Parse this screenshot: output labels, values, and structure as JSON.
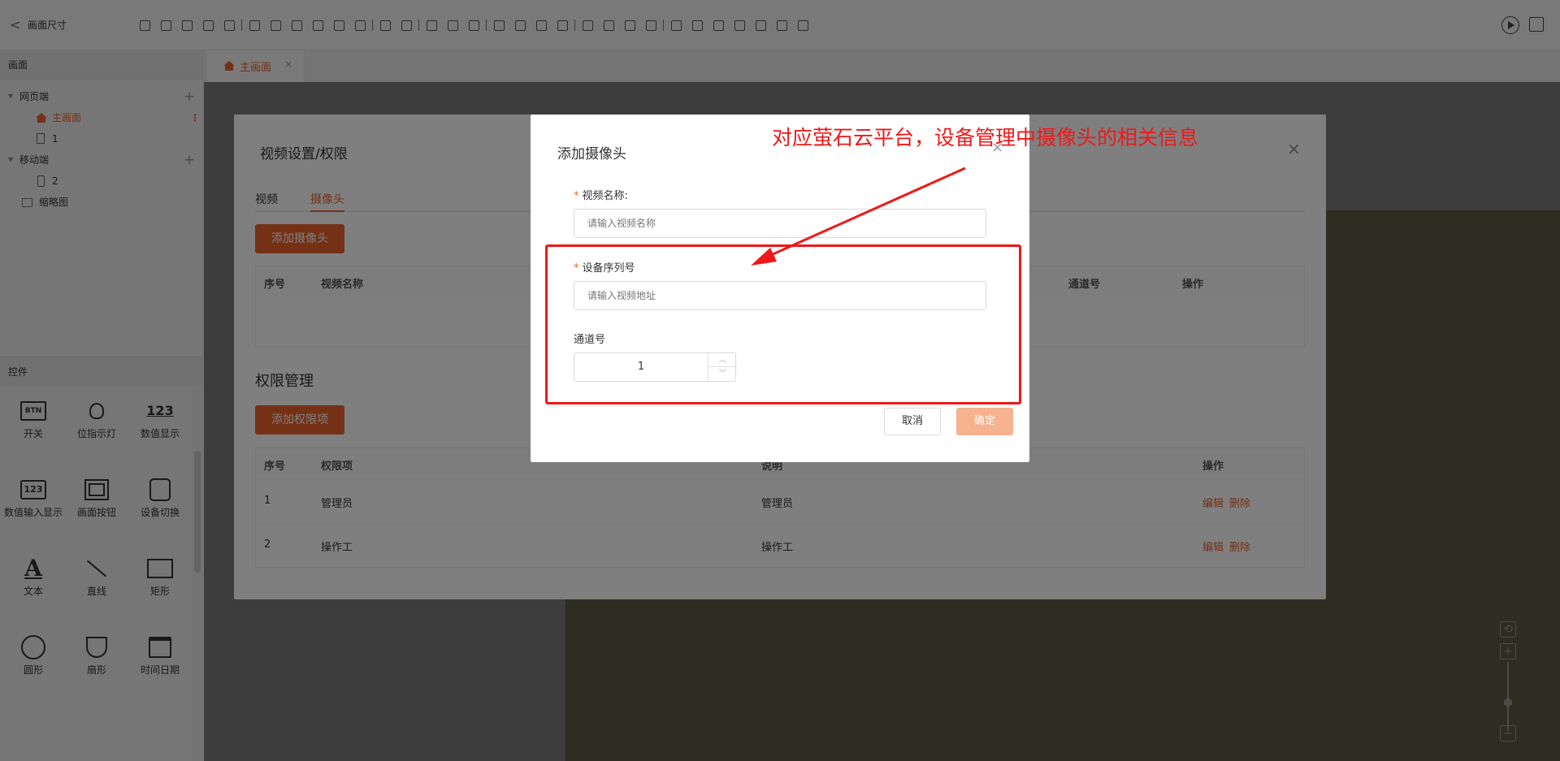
{
  "app": {
    "back_label": "<",
    "title": "画面尺寸"
  },
  "toolbar_icons": [
    "save-icon",
    "save-as-icon",
    "cut-icon",
    "copy-icon",
    "delete-icon",
    "|",
    "align-left-icon",
    "align-center-icon",
    "align-right-icon",
    "align-top-icon",
    "align-bottom-icon",
    "align-middle-icon",
    "|",
    "distribute-h-icon",
    "distribute-v-icon",
    "|",
    "group-icon",
    "ungroup-icon",
    "split-icon",
    "|",
    "image-icon",
    "layer-icon",
    "lock-icon",
    "unlock-icon",
    "|",
    "bring-front-icon",
    "send-back-icon",
    "layer-up-icon",
    "layer-down-icon",
    "|",
    "undo-icon",
    "redo-icon",
    "gallery-icon",
    "components-icon",
    "export-icon",
    "video-icon",
    "swap-icon"
  ],
  "left": {
    "screen_header": "画面",
    "tree": {
      "web_group": "网页端",
      "web_items": [
        "主画面",
        "1"
      ],
      "mobile_group": "移动端",
      "mobile_items": [
        "2"
      ],
      "thumbnail": "缩略图"
    },
    "controls_header": "控件",
    "controls": [
      {
        "label": "开关",
        "icon": "switch-btn-icon",
        "text": "BTN"
      },
      {
        "label": "位指示灯",
        "icon": "bulb-icon",
        "text": ""
      },
      {
        "label": "数值显示",
        "icon": "number-display-icon",
        "text": "123"
      },
      {
        "label": "数值输入显示",
        "icon": "number-input-icon",
        "text": "123"
      },
      {
        "label": "画面按钮",
        "icon": "screen-button-icon",
        "text": ""
      },
      {
        "label": "设备切换",
        "icon": "device-switch-icon",
        "text": ""
      },
      {
        "label": "文本",
        "icon": "text-icon",
        "text": "A"
      },
      {
        "label": "直线",
        "icon": "line-icon",
        "text": ""
      },
      {
        "label": "矩形",
        "icon": "rect-icon",
        "text": ""
      },
      {
        "label": "圆形",
        "icon": "circle-icon",
        "text": ""
      },
      {
        "label": "扇形",
        "icon": "sector-icon",
        "text": ""
      },
      {
        "label": "时间日期",
        "icon": "calendar-icon",
        "text": ""
      }
    ]
  },
  "tabs": [
    {
      "label": "主画面",
      "close": "×"
    }
  ],
  "video_panel": {
    "title": "视频设置/权限",
    "close": "×",
    "tabs": [
      "视频",
      "摄像头"
    ],
    "active_tab": 1,
    "add_camera_label": "添加摄像头",
    "camera_table_headers": [
      "序号",
      "视频名称",
      "通道号",
      "操作"
    ],
    "permission_title": "权限管理",
    "add_permission_label": "添加权限项",
    "permission_headers": [
      "序号",
      "权限项",
      "说明",
      "操作"
    ],
    "permission_rows": [
      {
        "no": "1",
        "item": "管理员",
        "desc": "管理员",
        "edit": "编辑",
        "delete": "删除"
      },
      {
        "no": "2",
        "item": "操作工",
        "desc": "操作工",
        "edit": "编辑",
        "delete": "删除"
      }
    ]
  },
  "modal": {
    "title": "添加摄像头",
    "close": "×",
    "video_name_label": "视频名称:",
    "video_name_placeholder": "请输入视频名称",
    "serial_label": "设备序列号",
    "serial_placeholder": "请输入视频地址",
    "channel_label": "通道号",
    "channel_value": "1",
    "required_mark": "*",
    "cancel_label": "取消",
    "ok_label": "确定"
  },
  "annotation": {
    "text": "对应萤石云平台，设备管理中摄像头的相关信息",
    "color": "#f01818"
  },
  "zoom": {
    "reset": "⟲",
    "zoom_in": "+",
    "zoom_out": "−"
  },
  "colors": {
    "accent": "#e8622c",
    "ok_disabled": "#f6b18f",
    "canvas": "#5b5b43"
  }
}
